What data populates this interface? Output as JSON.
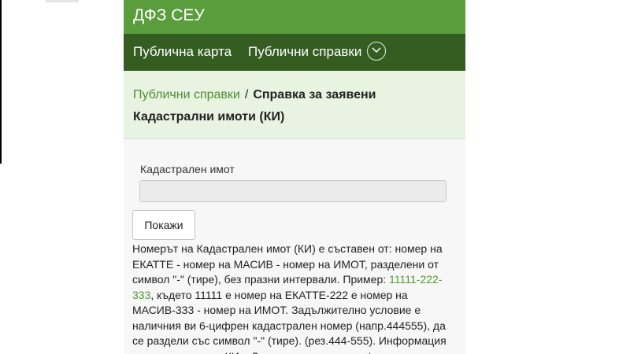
{
  "header": {
    "title": "ДФЗ СЕУ"
  },
  "nav": {
    "items": [
      {
        "label": "Публична карта"
      },
      {
        "label": "Публични справки"
      }
    ],
    "dropdown_icon": "chevron-down-circle-icon"
  },
  "breadcrumb": {
    "parent": "Публични справки",
    "separator": "/",
    "current": "Справка за заявени Кадастрални имоти (КИ)"
  },
  "form": {
    "field_label": "Кадастрален имот",
    "field_value": "",
    "submit_label": "Покажи"
  },
  "help": {
    "part1": "Номерът на Кадастрален имот (КИ) е съставен от: номер на ЕКАТТЕ - номер на МАСИВ - номер на ИМОТ, разделени от символ \"-\" (тире), без празни интервали. Пример: ",
    "example": "11111-222-333",
    "part2": ", където 11111 е номер на ЕКАТТЕ-222 е номер на МАСИВ-333 - номер на ИМОТ. Задължително условие е наличния ви 6-цифрен кадастрален номер (напр.444555), да се раздели със символ \"-\" (тире). (рез.444-555). Информация за пресичания на КИ с Декларирани парцели *"
  },
  "colors": {
    "brand_green": "#5a9d3c",
    "nav_dark_green": "#355d22",
    "breadcrumb_bg": "#e8f4e1",
    "link_green": "#4f9a2b"
  }
}
